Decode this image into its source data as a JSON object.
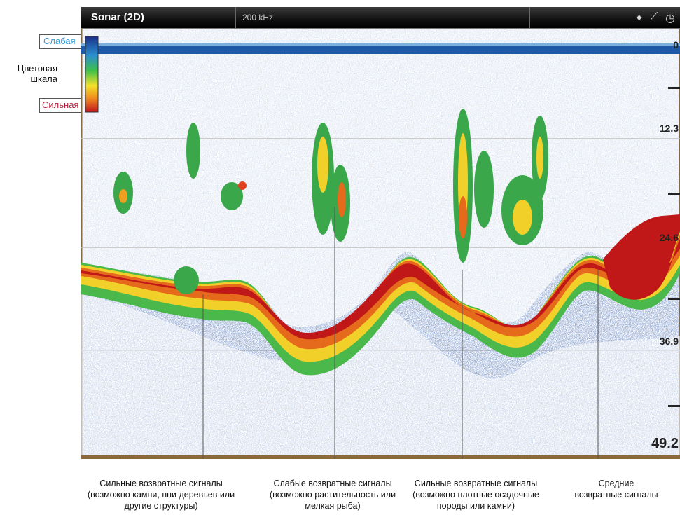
{
  "app": {
    "mode_title": "Sonar (2D)",
    "frequency": "200 kHz"
  },
  "color_scale": {
    "weak_label": "Слабая",
    "strong_label": "Сильная",
    "title": "Цветовая шкала",
    "weak_color": "#3b9fd8",
    "strong_color": "#b3203c"
  },
  "toolbar_icons": [
    "satellite-icon",
    "antenna-icon",
    "gauge-icon"
  ],
  "depth_scale": [
    "0",
    "12.3",
    "24.6",
    "36.9",
    "49.2"
  ],
  "annotations": [
    {
      "line1": "Сильные возвратные сигналы",
      "line2": "(возможно камни, пни деревьев или",
      "line3": "другие структуры)"
    },
    {
      "line1": "Слабые возвратные сигналы",
      "line2": "(возможно растительность или",
      "line3": "мелкая рыба)"
    },
    {
      "line1": "Сильные возвратные сигналы",
      "line2": "(возможно плотные осадочные",
      "line3": "породы или камни)"
    },
    {
      "line1": "Средние",
      "line2": "возвратные сигналы",
      "line3": ""
    }
  ]
}
